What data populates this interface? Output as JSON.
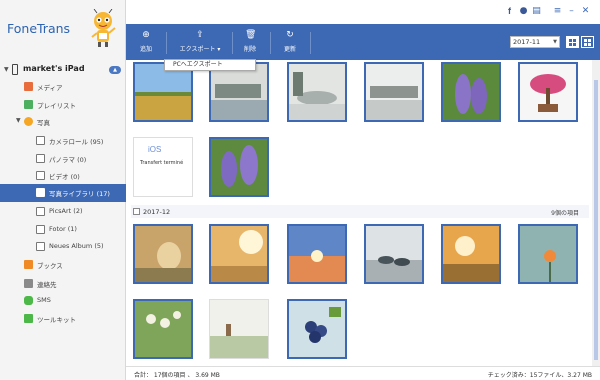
{
  "app": {
    "title": "FoneTrans"
  },
  "device": {
    "name": "market's iPad"
  },
  "sidebar": {
    "items": [
      {
        "label": "メディア",
        "icon": "media-icon",
        "color": "#e86c3c"
      },
      {
        "label": "プレイリスト",
        "icon": "playlist-icon",
        "color": "#4db060"
      },
      {
        "label": "写真",
        "icon": "photos-icon",
        "color": "#f5a623"
      },
      {
        "label": "カメラロール (95)",
        "icon": "camera-roll-icon",
        "color": "#777777"
      },
      {
        "label": "パノラマ (0)",
        "icon": "panorama-icon",
        "color": "#777777"
      },
      {
        "label": "ビデオ (0)",
        "icon": "video-icon",
        "color": "#777777"
      },
      {
        "label": "写真ライブラリ (17)",
        "icon": "photo-library-icon",
        "color": "#777777"
      },
      {
        "label": "PicsArt (2)",
        "icon": "album-icon",
        "color": "#777777"
      },
      {
        "label": "Fotor (1)",
        "icon": "album-icon",
        "color": "#777777"
      },
      {
        "label": "Neues Album (5)",
        "icon": "album-icon",
        "color": "#777777"
      },
      {
        "label": "ブックス",
        "icon": "books-icon",
        "color": "#f08a24"
      },
      {
        "label": "連絡先",
        "icon": "contacts-icon",
        "color": "#8a8a8a"
      },
      {
        "label": "SMS",
        "icon": "sms-icon",
        "color": "#4cb848"
      },
      {
        "label": "ツールキット",
        "icon": "toolkit-icon",
        "color": "#4cb848"
      }
    ]
  },
  "toolbar": {
    "add_label": "追加",
    "export_label": "エクスポート",
    "delete_label": "削除",
    "refresh_label": "更新"
  },
  "export_menu": {
    "item": "PCへエクスポート"
  },
  "date_filter": {
    "value": "2017-11"
  },
  "content": {
    "transfer_text": "Transfert terminé",
    "group": {
      "date": "2017-12",
      "count": "9個の項目"
    }
  },
  "status": {
    "left": "合計： 17個の項目 、 3.69 MB",
    "right": "チェック済み：15ファイル、3.27 MB"
  },
  "colors": {
    "accent": "#3d68b3",
    "selected": "#3d68b3"
  }
}
